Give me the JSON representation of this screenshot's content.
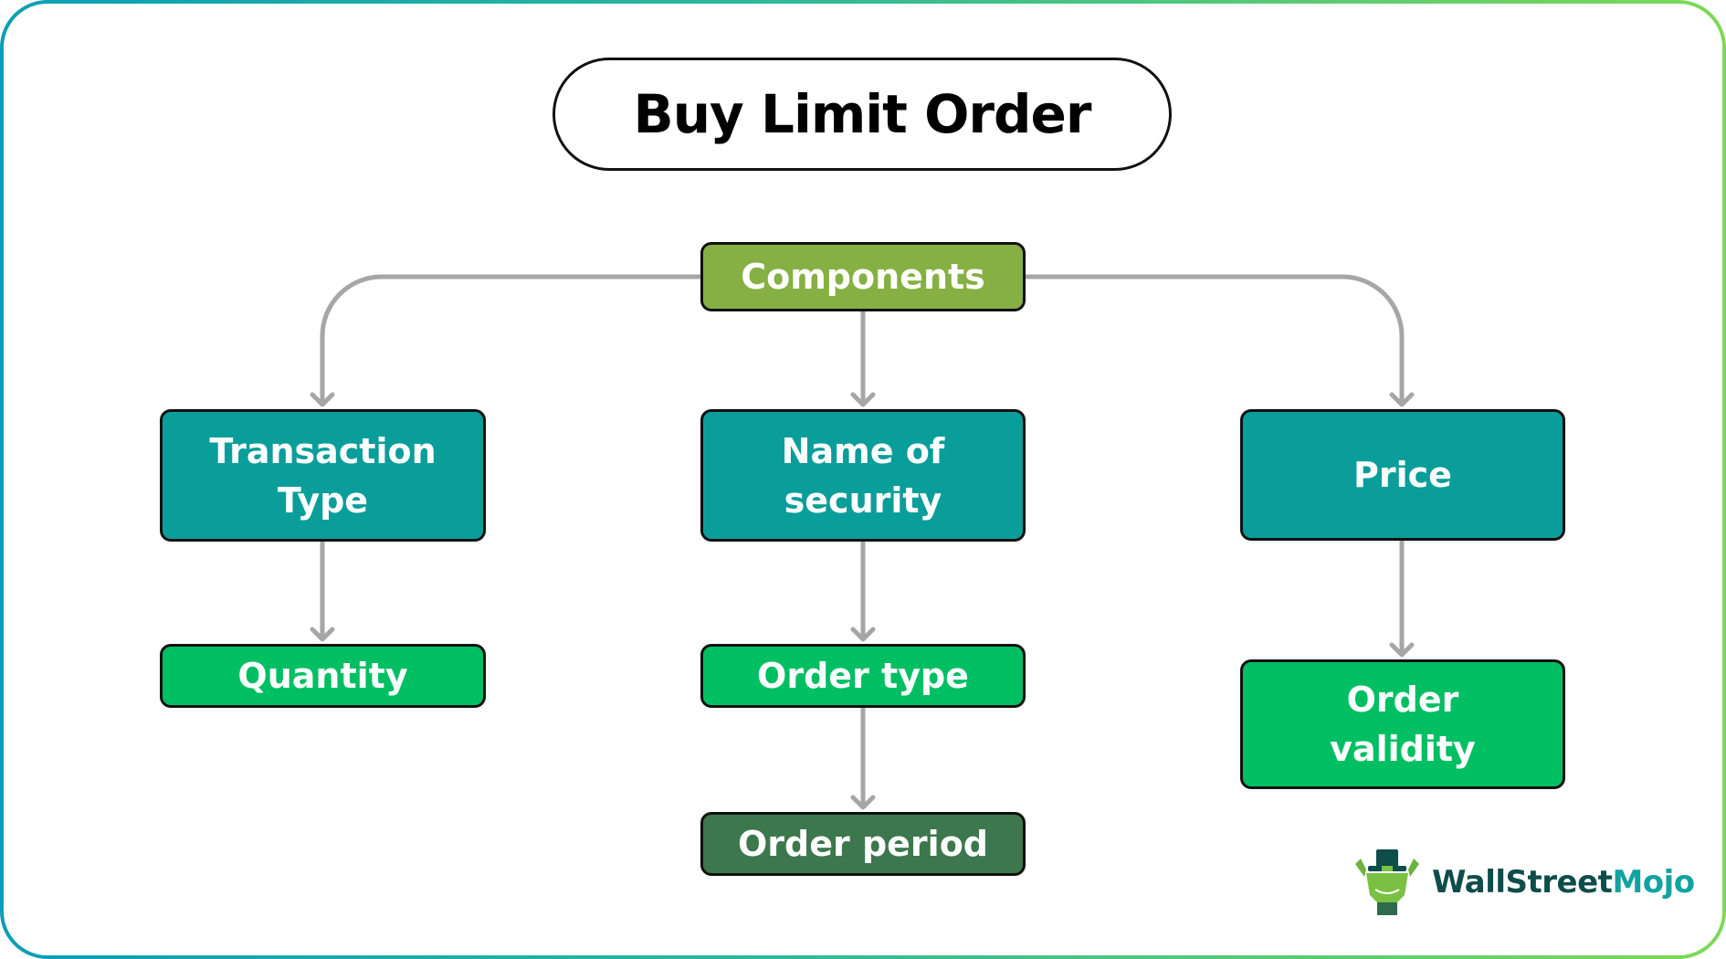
{
  "title": "Buy Limit Order",
  "colors": {
    "frame_gradient_start": "#0a9fb5",
    "frame_gradient_end": "#7ed957",
    "connector": "#a6a6a6",
    "root": "#86b043",
    "level1": "#0a9e9b",
    "level2": "#00bf63",
    "level3": "#3d774d",
    "logo_dark": "#0f4d4a",
    "logo_accent": "#10a3a0"
  },
  "nodes": {
    "components": "Components",
    "transaction_type": "Transaction\nType",
    "name_of_security": "Name of\nsecurity",
    "price": "Price",
    "quantity": "Quantity",
    "order_type": "Order type",
    "order_period": "Order period",
    "order_validity": "Order\nvalidity"
  },
  "edges": [
    [
      "components",
      "transaction_type"
    ],
    [
      "components",
      "name_of_security"
    ],
    [
      "components",
      "price"
    ],
    [
      "transaction_type",
      "quantity"
    ],
    [
      "name_of_security",
      "order_type"
    ],
    [
      "order_type",
      "order_period"
    ],
    [
      "price",
      "order_validity"
    ]
  ],
  "logo": {
    "brand_part1": "WallStreet",
    "brand_part2": "Mojo"
  }
}
